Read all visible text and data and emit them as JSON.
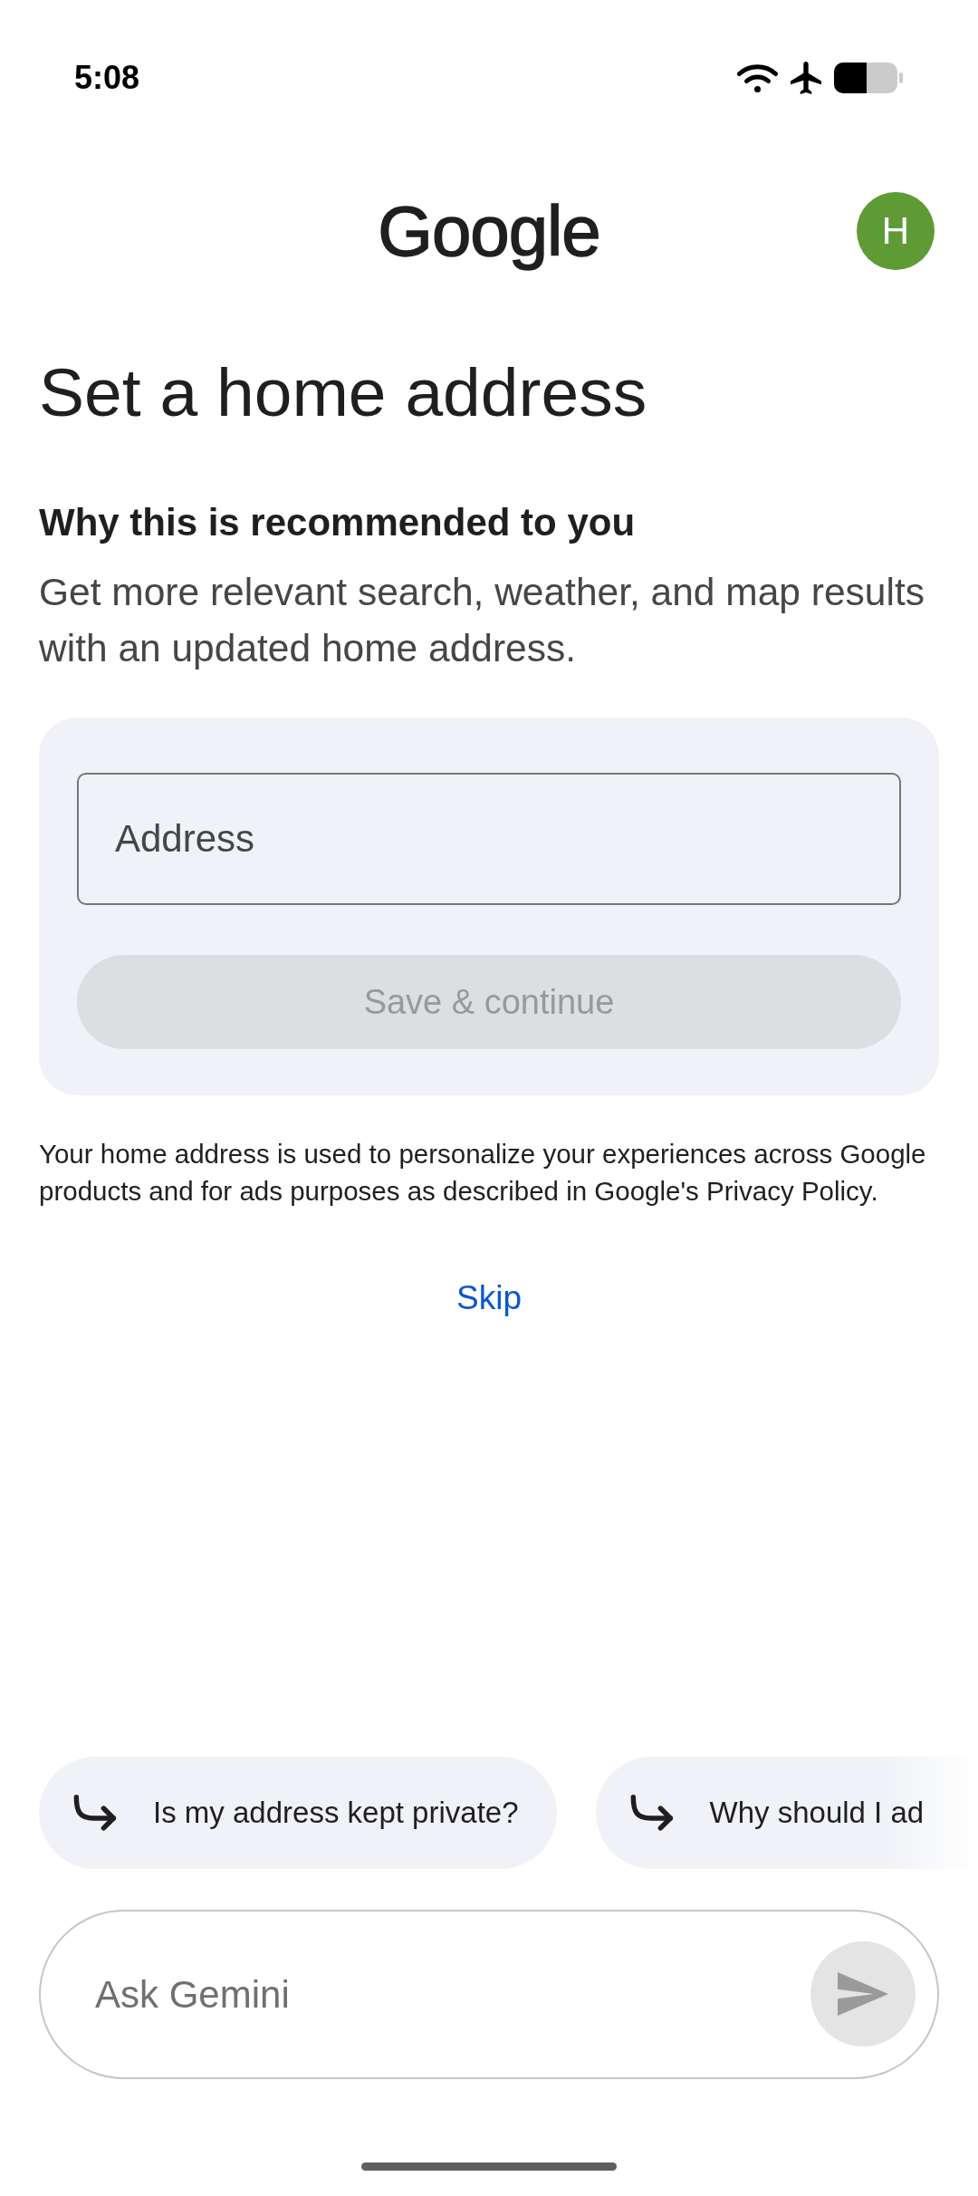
{
  "status_bar": {
    "time": "5:08"
  },
  "header": {
    "logo": "Google",
    "avatar_initial": "H"
  },
  "title": "Set a home address",
  "reason": {
    "heading": "Why this is recommended to you",
    "text": "Get more relevant search, weather, and map results with an updated home address."
  },
  "form": {
    "address": {
      "placeholder": "Address"
    },
    "save_button": {
      "label": "Save & continue",
      "disabled": true
    }
  },
  "privacy_note": "Your home address is used to personalize your experiences across Google products and for ads purposes as described in Google's Privacy Policy.",
  "skip_link": "Skip",
  "suggestions": [
    {
      "label": "Is my address kept private?"
    },
    {
      "label": "Why should I ad"
    }
  ],
  "prompt": {
    "placeholder": "Ask Gemini",
    "send_button": {
      "disabled": true
    }
  }
}
